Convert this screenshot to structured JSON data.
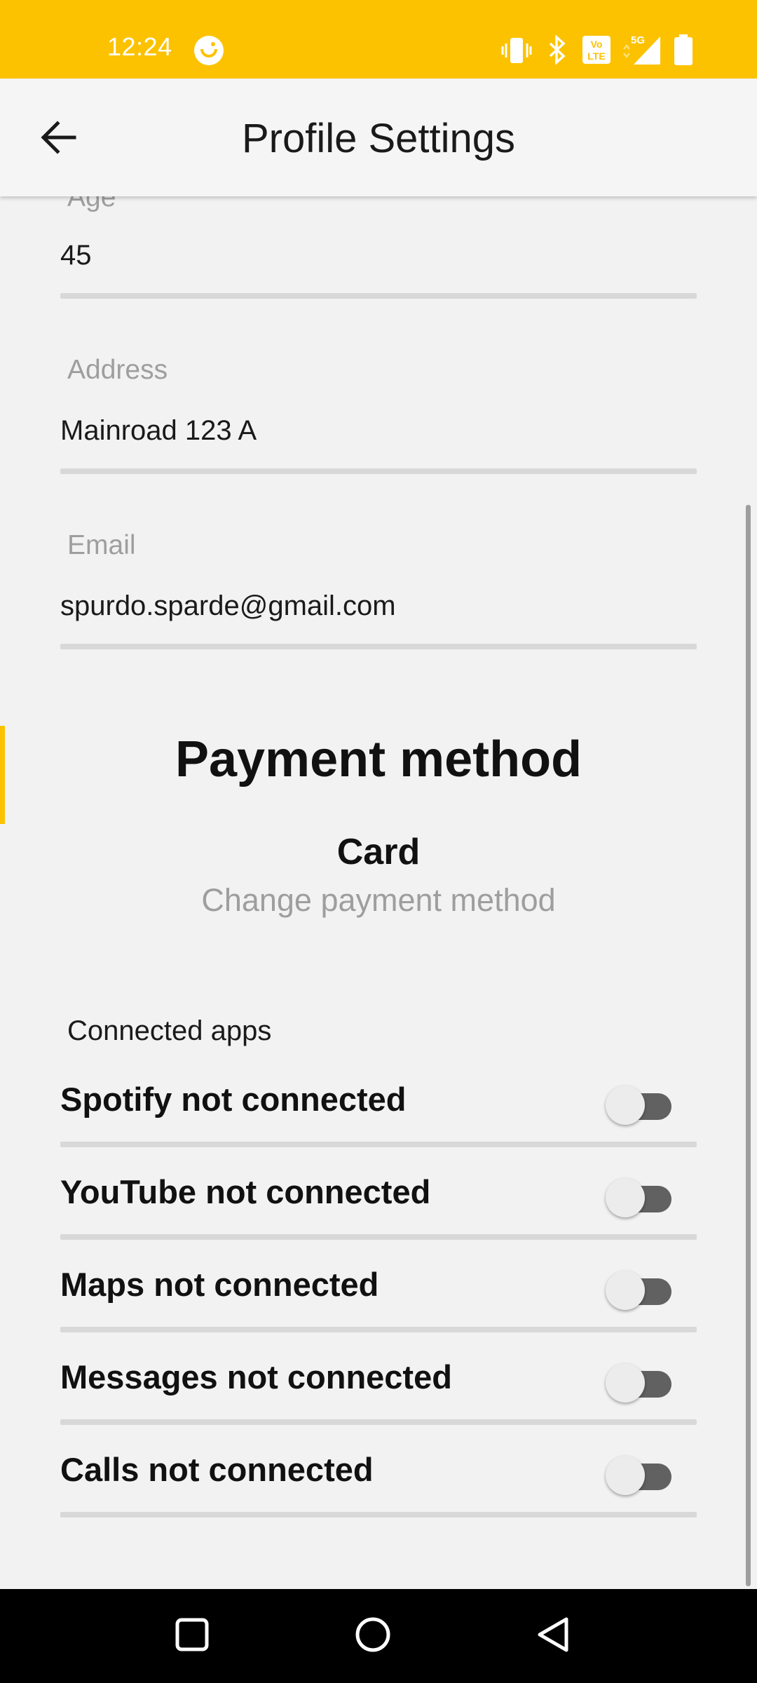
{
  "status_bar": {
    "time": "12:24",
    "icons": [
      "face-status-icon",
      "vibrate-icon",
      "bluetooth-icon",
      "volte-icon",
      "5g-signal-icon",
      "battery-icon"
    ],
    "network_label": "5G",
    "volte_label": "VoLTE",
    "background_color": "#fcc200"
  },
  "app_bar": {
    "back_icon": "arrow-back-icon",
    "title": "Profile Settings"
  },
  "profile": {
    "age_label": "Age",
    "age_value": "45",
    "address_label": "Address",
    "address_value": "Mainroad 123 A",
    "email_label": "Email",
    "email_value": "spurdo.sparde@gmail.com"
  },
  "payment": {
    "heading": "Payment method",
    "method": "Card",
    "change_link": "Change payment method"
  },
  "connected_apps": {
    "title": "Connected apps",
    "items": [
      {
        "label": "Spotify not connected",
        "enabled": false
      },
      {
        "label": "YouTube not connected",
        "enabled": false
      },
      {
        "label": "Maps not connected",
        "enabled": false
      },
      {
        "label": "Messages not connected",
        "enabled": false
      },
      {
        "label": "Calls not connected",
        "enabled": false
      }
    ]
  },
  "nav_bar": {
    "buttons": [
      "recents-square-icon",
      "home-circle-icon",
      "back-triangle-icon"
    ]
  },
  "colors": {
    "accent": "#fcc200",
    "background": "#f2f2f2",
    "switch_track_off": "#616161",
    "muted_text": "#9e9e9e"
  }
}
